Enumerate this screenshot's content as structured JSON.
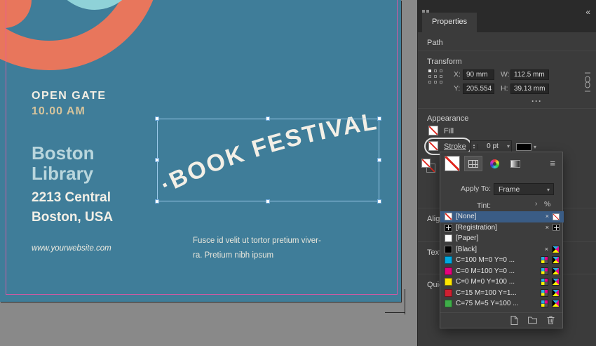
{
  "colors": {
    "poster_bg": "#3f7d99",
    "pasteboard": "#898989",
    "accent_orange": "#e8765c",
    "accent_cyan": "#8fd2d8",
    "guide_pink": "#e854a3",
    "selection_blue": "#9ac9e8",
    "panel_bg": "#3b3b3b",
    "highlight_row": "#3a5c85",
    "none_slash_red": "#e0231a"
  },
  "icons": {
    "collapse": "«",
    "menu": "≡",
    "caret": "▾",
    "spin_up": "▴",
    "spin_down": "▾",
    "not_editable": "×",
    "chevron": "›",
    "more_dots": "···"
  },
  "poster": {
    "open_gate": "OPEN GATE",
    "time": "10.00 AM",
    "venue_line1": "Boston",
    "venue_line2": "Library",
    "address_line1": "2213 Central",
    "address_line2": "Boston, USA",
    "website": "www.yourwebsite.com",
    "arc_text": "·BOOK FESTIVAL",
    "body_line1": "Fusce id velit ut tortor pretium viver-",
    "body_line2": "ra. Pretium nibh ipsum"
  },
  "properties_panel": {
    "tab_label": "Properties",
    "path_label": "Path",
    "transform": {
      "title": "Transform",
      "x_label": "X:",
      "x_value": "90 mm",
      "y_label": "Y:",
      "y_value": "205.554 mm",
      "w_label": "W:",
      "w_value": "112.5 mm",
      "h_label": "H:",
      "h_value": "39.13 mm"
    },
    "appearance": {
      "title": "Appearance",
      "fill_label": "Fill",
      "stroke_label": "Stroke",
      "stroke_weight": "0 pt"
    },
    "more_sections": {
      "align": "Align",
      "text_wrap": "Text Wrap",
      "quick_actions": "Quick Actions"
    }
  },
  "swatches_panel": {
    "apply_to_label": "Apply To:",
    "apply_to_value": "Frame",
    "tint_label": "Tint:",
    "percent_sign": "%",
    "swatches": [
      {
        "name": "[None]"
      },
      {
        "name": "[Registration]"
      },
      {
        "name": "[Paper]"
      },
      {
        "name": "[Black]"
      },
      {
        "name": "C=100 M=0 Y=0 ...",
        "hex": "#00a9e0"
      },
      {
        "name": "C=0 M=100 Y=0 ...",
        "hex": "#e5007d"
      },
      {
        "name": "C=0 M=0 Y=100 ...",
        "hex": "#ffe600"
      },
      {
        "name": "C=15 M=100 Y=1...",
        "hex": "#cf2031"
      },
      {
        "name": "C=75 M=5 Y=100 ...",
        "hex": "#3fae49"
      }
    ]
  }
}
